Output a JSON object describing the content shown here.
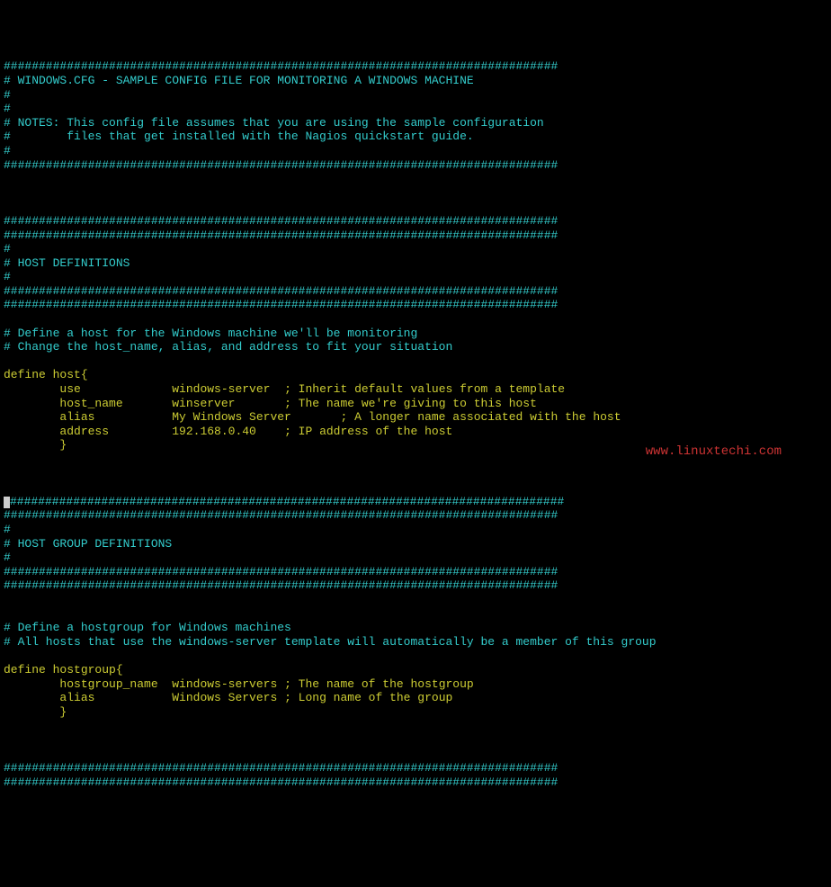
{
  "header": {
    "hash_line": "###############################################################################",
    "prefix": "#",
    "title_line": "# WINDOWS.CFG - SAMPLE CONFIG FILE FOR MONITORING A WINDOWS MACHINE",
    "notes_line1": "# NOTES: This config file assumes that you are using the sample configuration",
    "notes_line2": "#        files that get installed with the Nagios quickstart guide."
  },
  "host_section": {
    "hash_line": "###############################################################################",
    "title": "# HOST DEFINITIONS",
    "prefix": "#",
    "comment1": "# Define a host for the Windows machine we'll be monitoring",
    "comment2": "# Change the host_name, alias, and address to fit your situation"
  },
  "host_def": {
    "open": "define host{",
    "use_key": "        use             ",
    "use_val": "windows-server  ",
    "use_comment": "; Inherit default values from a template",
    "hostname_key": "        host_name       ",
    "hostname_val": "winserver       ",
    "hostname_comment": "; The name we're giving to this host",
    "alias_key": "        alias           ",
    "alias_val": "My Windows Server       ",
    "alias_comment": "; A longer name associated with the host",
    "address_key": "        address         ",
    "address_val": "192.168.0.40    ",
    "address_comment": "; IP address of the host",
    "close": "        }"
  },
  "hostgroup_section": {
    "hash_line": "###############################################################################",
    "title": "# HOST GROUP DEFINITIONS",
    "prefix": "#",
    "comment1": "# Define a hostgroup for Windows machines",
    "comment2": "# All hosts that use the windows-server template will automatically be a member of this group"
  },
  "hostgroup_def": {
    "open": "define hostgroup{",
    "name_key": "        hostgroup_name  ",
    "name_val": "windows-servers ",
    "name_comment": "; The name of the hostgroup",
    "alias_key": "        alias           ",
    "alias_val": "Windows Servers ",
    "alias_comment": "; Long name of the group",
    "close": "        }"
  },
  "watermark": "www.linuxtechi.com"
}
